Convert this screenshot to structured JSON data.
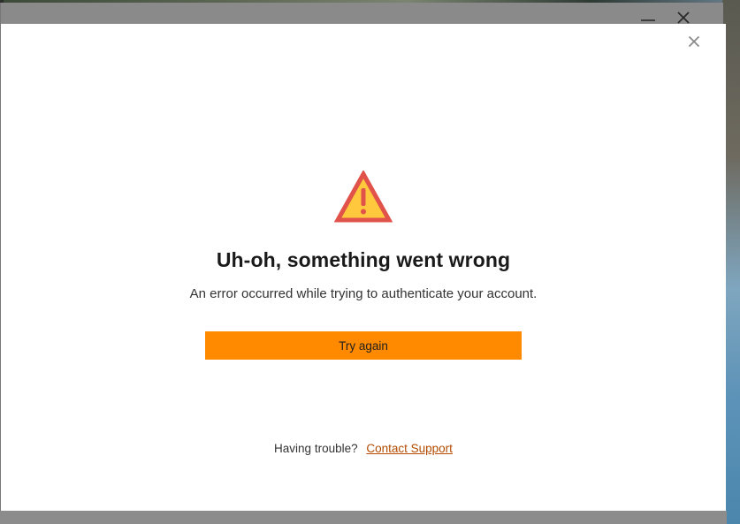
{
  "window": {
    "minimize_label": "Minimize",
    "close_label": "Close"
  },
  "dialog": {
    "close_label": "Close dialog",
    "icon": "warning-triangle-icon",
    "headline": "Uh-oh, something went wrong",
    "message": "An error occurred while trying to authenticate your account.",
    "retry_button": "Try again",
    "trouble_text": "Having trouble?",
    "support_link": "Contact Support"
  },
  "colors": {
    "accent": "#ff8a00",
    "warning_fill": "#ffc83d",
    "warning_border": "#e0524a",
    "link": "#b34a00"
  }
}
